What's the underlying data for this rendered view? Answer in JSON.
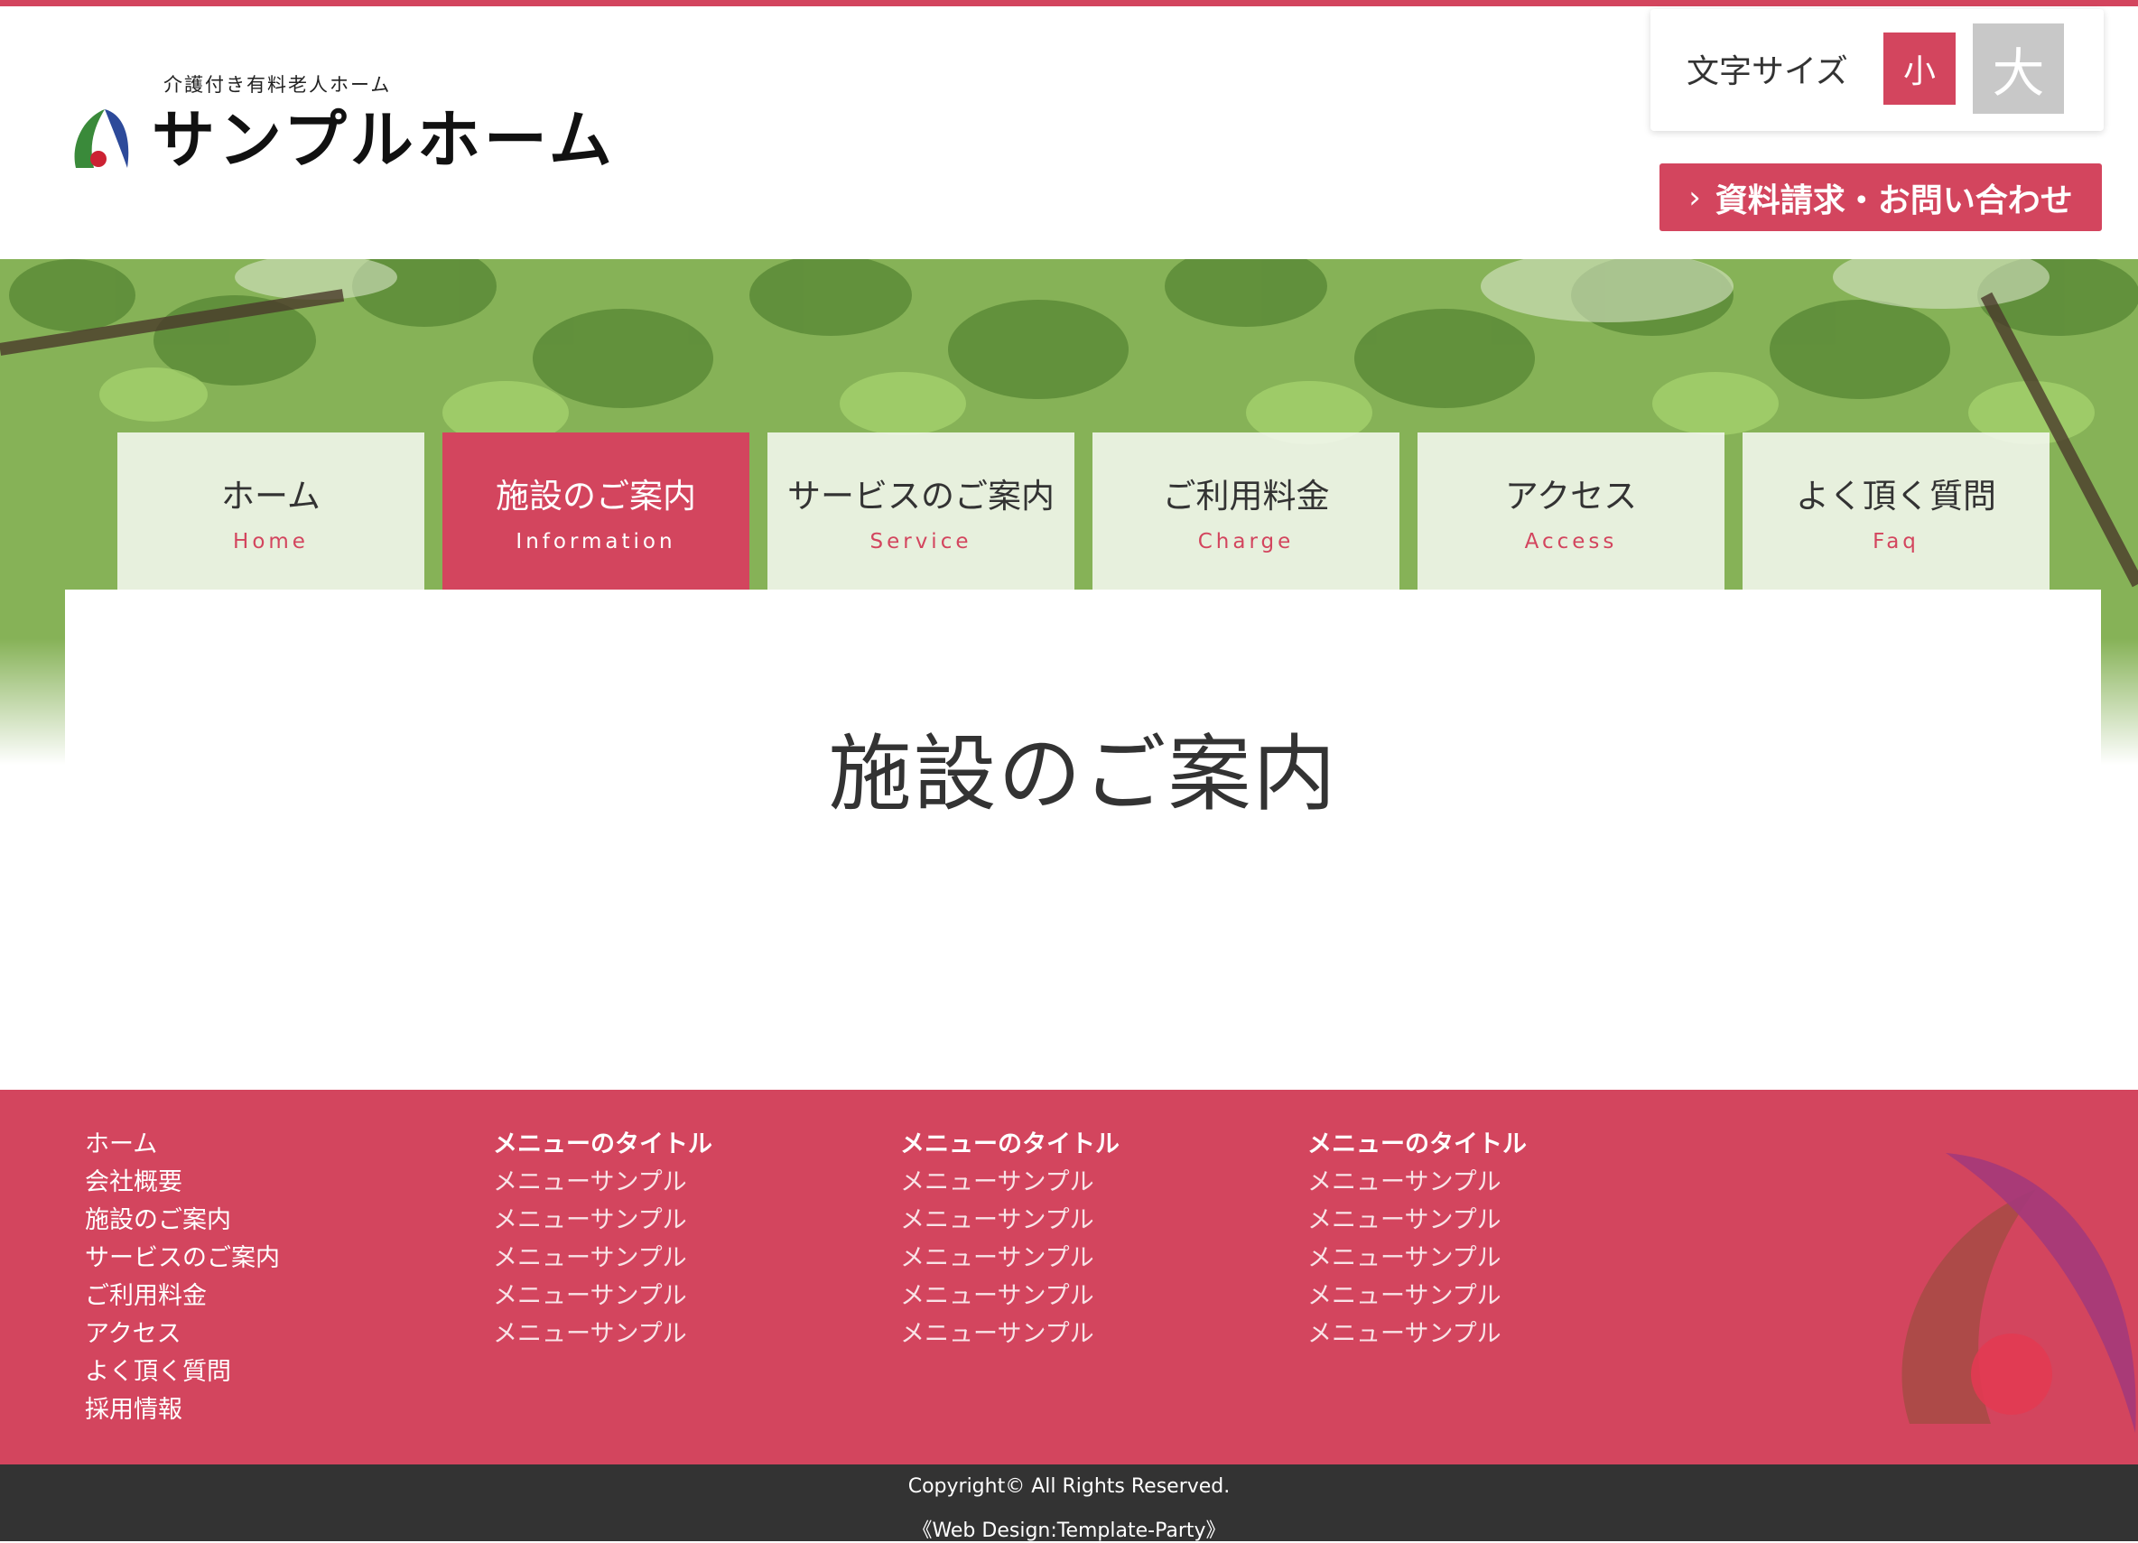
{
  "header": {
    "logo_sub": "介護付き有料老人ホーム",
    "logo_main": "サンプルホーム",
    "font_size_label": "文字サイズ",
    "font_small": "小",
    "font_large": "大",
    "contact_chevron": "›",
    "contact_label": "資料請求・お問い合わせ"
  },
  "nav": {
    "items": [
      {
        "jp": "ホーム",
        "en": "Home"
      },
      {
        "jp": "施設のご案内",
        "en": "Information"
      },
      {
        "jp": "サービスのご案内",
        "en": "Service"
      },
      {
        "jp": "ご利用料金",
        "en": "Charge"
      },
      {
        "jp": "アクセス",
        "en": "Access"
      },
      {
        "jp": "よく頂く質問",
        "en": "Faq"
      }
    ]
  },
  "main": {
    "title": "施設のご案内"
  },
  "footer": {
    "col1": [
      "ホーム",
      "会社概要",
      "施設のご案内",
      "サービスのご案内",
      "ご利用料金",
      "アクセス",
      "よく頂く質問",
      "採用情報"
    ],
    "col2": {
      "title": "メニューのタイトル",
      "items": [
        "メニューサンプル",
        "メニューサンプル",
        "メニューサンプル",
        "メニューサンプル",
        "メニューサンプル"
      ]
    },
    "col3": {
      "title": "メニューのタイトル",
      "items": [
        "メニューサンプル",
        "メニューサンプル",
        "メニューサンプル",
        "メニューサンプル",
        "メニューサンプル"
      ]
    },
    "col4": {
      "title": "メニューのタイトル",
      "items": [
        "メニューサンプル",
        "メニューサンプル",
        "メニューサンプル",
        "メニューサンプル",
        "メニューサンプル"
      ]
    },
    "copyright": "Copyright© All Rights Reserved.",
    "credit": "《Web Design:Template-Party》"
  },
  "colors": {
    "accent": "#d3455e",
    "inactive_font_button": "#c8c8c8",
    "copyright_bg": "#333333"
  }
}
